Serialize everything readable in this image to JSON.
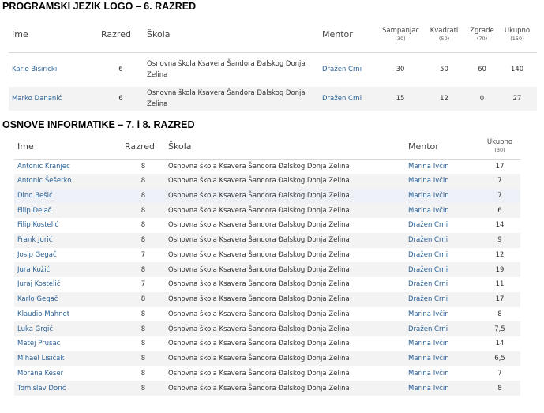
{
  "section1": {
    "title": "PROGRAMSKI JEZIK LOGO – 6. RAZRED",
    "headers": {
      "ime": "Ime",
      "razred": "Razred",
      "skola": "Škola",
      "mentor": "Mentor",
      "sampanjac": "Sampanjac",
      "sampanjac_max": "(30)",
      "kvadrati": "Kvadrati",
      "kvadrati_max": "(50)",
      "zgrade": "Zgrade",
      "zgrade_max": "(70)",
      "ukupno": "Ukupno",
      "ukupno_max": "(150)"
    },
    "rows": [
      {
        "name": "Karlo Bisiricki",
        "razred": "6",
        "school": "Osnovna škola Ksavera Šandora Đalskog Donja Zelina",
        "mentor": "Dražen Crni",
        "sampanjac": "30",
        "kvadrati": "50",
        "zgrade": "60",
        "ukupno": "140"
      },
      {
        "name": "Marko Dananić",
        "razred": "6",
        "school": "Osnovna škola Ksavera Šandora Đalskog Donja Zelina",
        "mentor": "Dražen Crni",
        "sampanjac": "15",
        "kvadrati": "12",
        "zgrade": "0",
        "ukupno": "27"
      }
    ]
  },
  "section2": {
    "title": "OSNOVE INFORMATIKE – 7. i 8. RAZRED",
    "headers": {
      "ime": "Ime",
      "razred": "Razred",
      "skola": "Škola",
      "mentor": "Mentor",
      "ukupno": "Ukupno",
      "ukupno_max": "(30)"
    },
    "rows": [
      {
        "name": "Antonic Kranjec",
        "razred": "8",
        "school": "Osnovna škola Ksavera Šandora Đalskog Donja Zelina",
        "mentor": "Marina Ivčin",
        "ukupno": "17"
      },
      {
        "name": "Antonic Šešerko",
        "razred": "8",
        "school": "Osnovna škola Ksavera Šandora Đalskog Donja Zelina",
        "mentor": "Marina Ivčin",
        "ukupno": "7"
      },
      {
        "name": "Dino Bešić",
        "razred": "8",
        "school": "Osnovna škola Ksavera Šandora Đalskog Donja Zelina",
        "mentor": "Marina Ivčin",
        "ukupno": "7"
      },
      {
        "name": "Filip Delač",
        "razred": "8",
        "school": "Osnovna škola Ksavera Šandora Đalskog Donja Zelina",
        "mentor": "Marina Ivčin",
        "ukupno": "6"
      },
      {
        "name": "Filip Kostelić",
        "razred": "8",
        "school": "Osnovna škola Ksavera Šandora Đalskog Donja Zelina",
        "mentor": "Dražen Crni",
        "ukupno": "14"
      },
      {
        "name": "Frank Jurić",
        "razred": "8",
        "school": "Osnovna škola Ksavera Šandora Đalskog Donja Zelina",
        "mentor": "Dražen Crni",
        "ukupno": "9"
      },
      {
        "name": "Josip Gegač",
        "razred": "7",
        "school": "Osnovna škola Ksavera Šandora Đalskog Donja Zelina",
        "mentor": "Dražen Crni",
        "ukupno": "12"
      },
      {
        "name": "Jura Kožić",
        "razred": "8",
        "school": "Osnovna škola Ksavera Šandora Đalskog Donja Zelina",
        "mentor": "Dražen Crni",
        "ukupno": "19"
      },
      {
        "name": "Juraj Kostelić",
        "razred": "7",
        "school": "Osnovna škola Ksavera Šandora Đalskog Donja Zelina",
        "mentor": "Dražen Crni",
        "ukupno": "11"
      },
      {
        "name": "Karlo Gegač",
        "razred": "8",
        "school": "Osnovna škola Ksavera Šandora Đalskog Donja Zelina",
        "mentor": "Dražen Crni",
        "ukupno": "17"
      },
      {
        "name": "Klaudio Mahnet",
        "razred": "8",
        "school": "Osnovna škola Ksavera Šandora Đalskog Donja Zelina",
        "mentor": "Marina Ivčin",
        "ukupno": "8"
      },
      {
        "name": "Luka Grgić",
        "razred": "8",
        "school": "Osnovna škola Ksavera Šandora Đalskog Donja Zelina",
        "mentor": "Dražen Crni",
        "ukupno": "7,5"
      },
      {
        "name": "Matej Prusac",
        "razred": "8",
        "school": "Osnovna škola Ksavera Šandora Đalskog Donja Zelina",
        "mentor": "Marina Ivčin",
        "ukupno": "14"
      },
      {
        "name": "Mihael Lisičak",
        "razred": "8",
        "school": "Osnovna škola Ksavera Šandora Đalskog Donja Zelina",
        "mentor": "Marina Ivčin",
        "ukupno": "6,5"
      },
      {
        "name": "Morana Keser",
        "razred": "8",
        "school": "Osnovna škola Ksavera Šandora Đalskog Donja Zelina",
        "mentor": "Marina Ivčin",
        "ukupno": "7"
      },
      {
        "name": "Tomislav Dorić",
        "razred": "8",
        "school": "Osnovna škola Ksavera Šandora Đalskog Donja Zelina",
        "mentor": "Marina Ivčin",
        "ukupno": "8"
      }
    ]
  }
}
